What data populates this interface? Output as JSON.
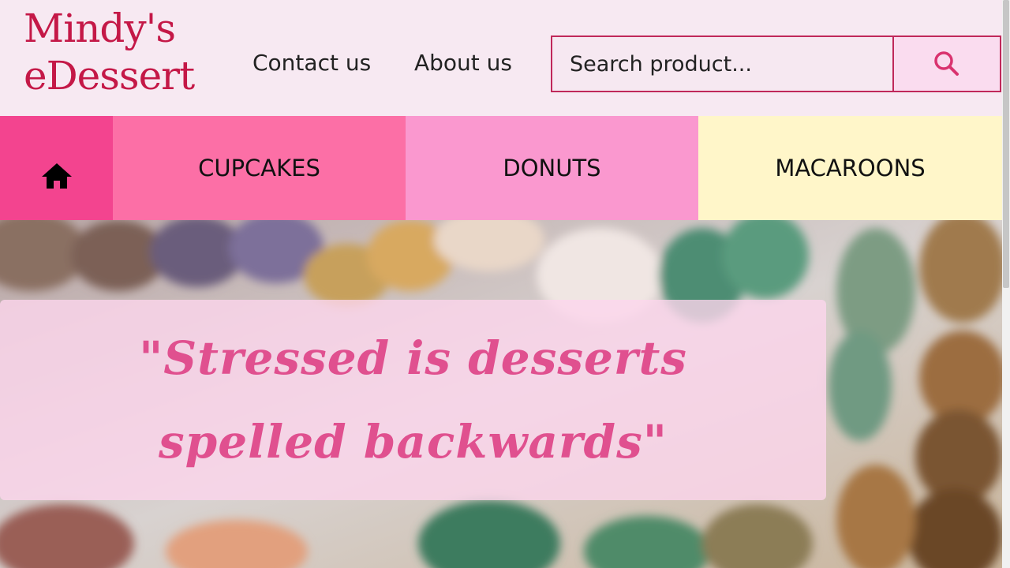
{
  "header": {
    "logo_line1": "Mindy's",
    "logo_line2": "eDessert",
    "links": [
      "Contact us",
      "About us"
    ]
  },
  "search": {
    "placeholder": "Search product..."
  },
  "nav": {
    "items": [
      "CUPCAKES",
      "DONUTS",
      "MACAROONS"
    ]
  },
  "hero": {
    "quote": "\"Stressed is desserts spelled backwards\""
  },
  "icons": {
    "home": "home-icon",
    "search": "search-icon"
  },
  "colors": {
    "brand": "#c41847",
    "nav_home": "#f3448f",
    "nav_cupcakes": "#fc6fa6",
    "nav_donuts": "#fa98cf",
    "nav_macaroons": "#fff6c9",
    "quote": "#e0508f"
  }
}
